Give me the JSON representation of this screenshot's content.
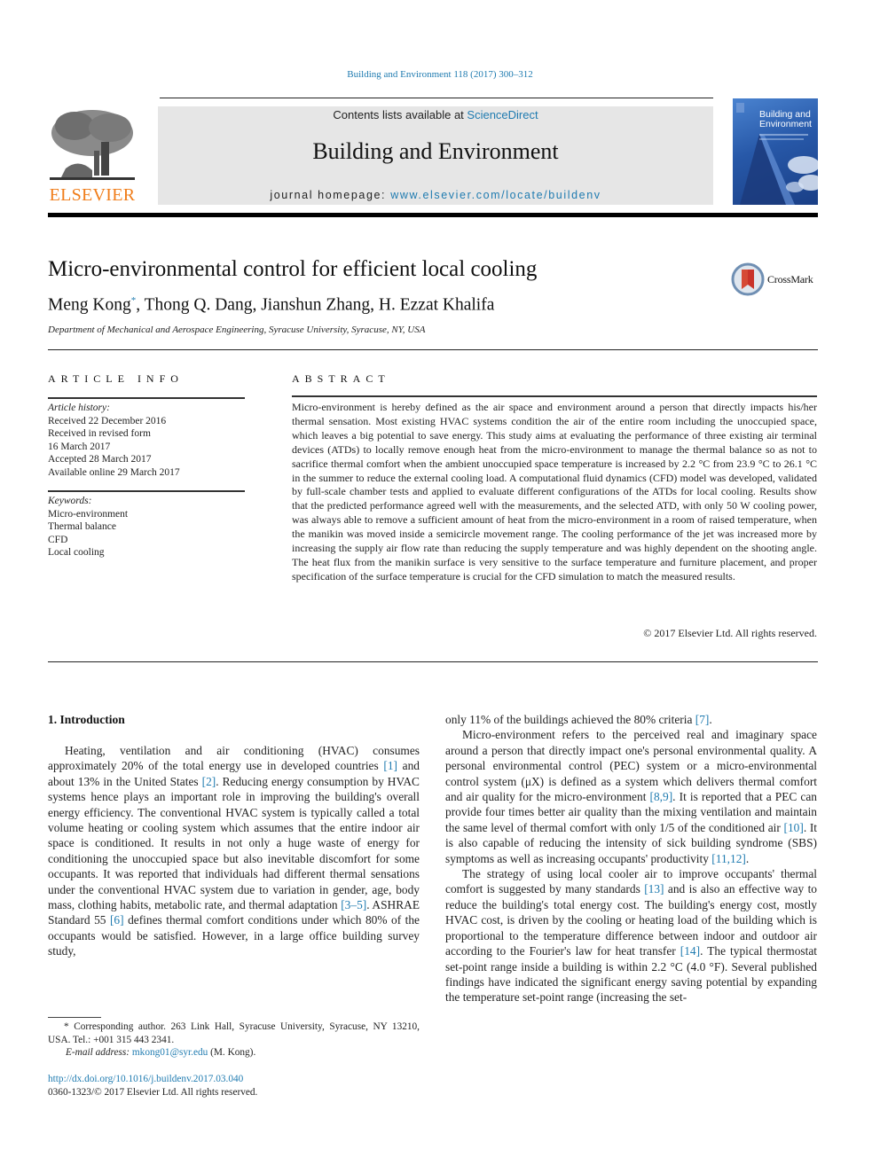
{
  "header": {
    "citation": "Building and Environment 118 (2017) 300–312",
    "contents_prefix": "Contents lists available at ",
    "contents_link": "ScienceDirect",
    "journal_name": "Building and Environment",
    "homepage_prefix": "journal homepage: ",
    "homepage_link": "www.elsevier.com/locate/buildenv",
    "publisher_logo_text": "ELSEVIER",
    "cover_title_line1": "Building and",
    "cover_title_line2": "Environment",
    "colors": {
      "link": "#1f7bb0",
      "elsevier_orange": "#f07d1a",
      "masthead_bg": "#e6e6e6"
    }
  },
  "article": {
    "title": "Micro-environmental control for efficient local cooling",
    "authors": [
      {
        "name": "Meng Kong",
        "mark": "*"
      },
      {
        "name": "Thong Q. Dang"
      },
      {
        "name": "Jianshun Zhang"
      },
      {
        "name": "H. Ezzat Khalifa"
      }
    ],
    "authors_rest": ", Thong Q. Dang, Jianshun Zhang, H. Ezzat Khalifa",
    "affiliation": "Department of Mechanical and Aerospace Engineering, Syracuse University, Syracuse, NY, USA",
    "crossmark_label": "CrossMark"
  },
  "article_info": {
    "heading": "ARTICLE INFO",
    "history_label": "Article history:",
    "history": [
      "Received 22 December 2016",
      "Received in revised form",
      "16 March 2017",
      "Accepted 28 March 2017",
      "Available online 29 March 2017"
    ],
    "keywords_label": "Keywords:",
    "keywords": [
      "Micro-environment",
      "Thermal balance",
      "CFD",
      "Local cooling"
    ]
  },
  "abstract": {
    "heading": "ABSTRACT",
    "text": "Micro-environment is hereby defined as the air space and environment around a person that directly impacts his/her thermal sensation. Most existing HVAC systems condition the air of the entire room including the unoccupied space, which leaves a big potential to save energy. This study aims at evaluating the performance of three existing air terminal devices (ATDs) to locally remove enough heat from the micro-environment to manage the thermal balance so as not to sacrifice thermal comfort when the ambient unoccupied space temperature is increased by 2.2 °C from 23.9 °C to 26.1 °C in the summer to reduce the external cooling load. A computational fluid dynamics (CFD) model was developed, validated by full-scale chamber tests and applied to evaluate different configurations of the ATDs for local cooling. Results show that the predicted performance agreed well with the measurements, and the selected ATD, with only 50 W cooling power, was always able to remove a sufficient amount of heat from the micro-environment in a room of raised temperature, when the manikin was moved inside a semicircle movement range. The cooling performance of the jet was increased more by increasing the supply air flow rate than reducing the supply temperature and was highly dependent on the shooting angle. The heat flux from the manikin surface is very sensitive to the surface temperature and furniture placement, and proper specification of the surface temperature is crucial for the CFD simulation to match the measured results.",
    "copyright": "© 2017 Elsevier Ltd. All rights reserved."
  },
  "introduction": {
    "heading": "1.  Introduction",
    "left_paragraph": [
      "Heating, ventilation and air conditioning (HVAC) consumes approximately 20% of the total energy use in developed countries ",
      "[1]",
      " and about 13% in the United States ",
      "[2]",
      ". Reducing energy consumption by HVAC systems hence plays an important role in improving the building's overall energy efficiency. The conventional HVAC system is typically called a total volume heating or cooling system which assumes that the entire indoor air space is conditioned. It results in not only a huge waste of energy for conditioning the unoccupied space but also inevitable discomfort for some occupants. It was reported that individuals had different thermal sensations under the conventional HVAC system due to variation in gender, age, body mass, clothing habits, metabolic rate, and thermal adaptation ",
      "[3–5]",
      ". ASHRAE Standard 55 ",
      "[6]",
      " defines thermal comfort conditions under which 80% of the occupants would be satisfied. However, in a large office building survey study,"
    ],
    "right_para1": [
      "only 11% of the buildings achieved the 80% criteria ",
      "[7]",
      "."
    ],
    "right_para2": [
      "Micro-environment refers to the perceived real and imaginary space around a person that directly impact one's personal environmental quality. A personal environmental control (PEC) system or a micro-environmental control system (μX) is defined as a system which delivers thermal comfort and air quality for the micro-environment ",
      "[8,9]",
      ". It is reported that a PEC can provide four times better air quality than the mixing ventilation and maintain the same level of thermal comfort with only 1/5 of the conditioned air ",
      "[10]",
      ". It is also capable of reducing the intensity of sick building syndrome (SBS) symptoms as well as increasing occupants' productivity ",
      "[11,12]",
      "."
    ],
    "right_para3": [
      "The strategy of using local cooler air to improve occupants' thermal comfort is suggested by many standards ",
      "[13]",
      " and is also an effective way to reduce the building's total energy cost. The building's energy cost, mostly HVAC cost, is driven by the cooling or heating load of the building which is proportional to the temperature difference between indoor and outdoor air according to the Fourier's law for heat transfer ",
      "[14]",
      ". The typical thermostat set-point range inside a building is within 2.2 °C (4.0 °F). Several published findings have indicated the significant energy saving potential by expanding the temperature set-point range (increasing the set-"
    ]
  },
  "footnote": {
    "corresponding": "* Corresponding author. 263 Link Hall, Syracuse University, Syracuse, NY 13210, USA. Tel.: +001 315 443 2341.",
    "email_label": "E-mail address: ",
    "email": "mkong01@syr.edu",
    "email_suffix": " (M. Kong).",
    "doi": "http://dx.doi.org/10.1016/j.buildenv.2017.03.040",
    "issn": "0360-1323/© 2017 Elsevier Ltd. All rights reserved."
  }
}
